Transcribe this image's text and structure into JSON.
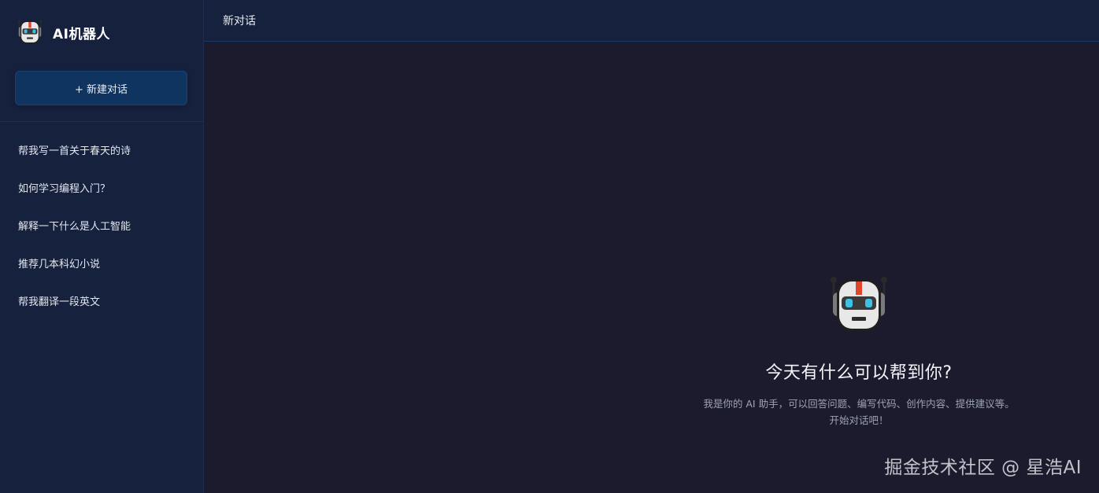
{
  "app": {
    "name": "AI机器人",
    "icon": "robot-icon"
  },
  "sidebar": {
    "new_chat_label": "+ 新建对话",
    "history": [
      {
        "label": "帮我写一首关于春天的诗"
      },
      {
        "label": "如何学习编程入门？"
      },
      {
        "label": "解释一下什么是人工智能"
      },
      {
        "label": "推荐几本科幻小说"
      },
      {
        "label": "帮我翻译一段英文"
      }
    ]
  },
  "header": {
    "title": "新对话"
  },
  "welcome": {
    "icon": "robot-icon",
    "heading": "今天有什么可以帮到你?",
    "description": "我是你的 AI 助手，可以回答问题、编写代码、创作内容、提供建议等。开始对话吧！"
  },
  "watermark": {
    "text": "掘金技术社区 @ 星浩AI"
  },
  "colors": {
    "sidebar_bg": "#16213e",
    "main_bg": "#1c1b2e",
    "button_bg": "#0f3460",
    "robot_accent_red": "#e0452b",
    "robot_eye_cyan": "#3fc0e8"
  }
}
